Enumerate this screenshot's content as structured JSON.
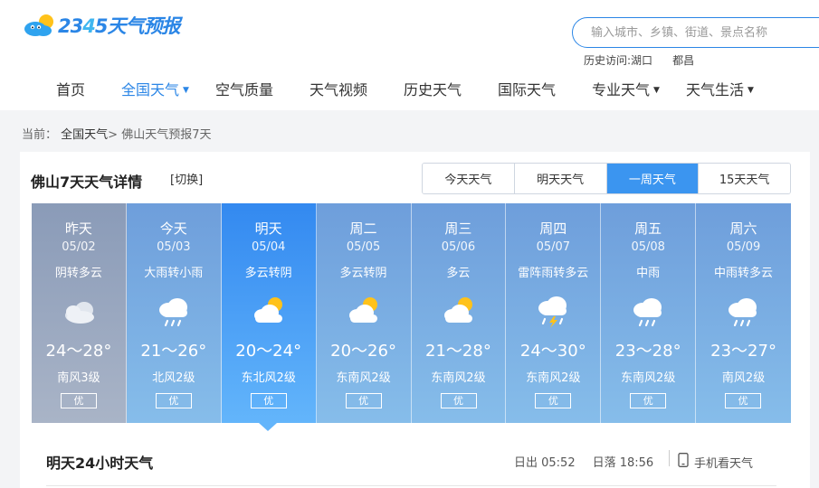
{
  "brand": {
    "logo_text_a": "23",
    "logo_text_4": "4",
    "logo_text_b": "5天气预报"
  },
  "search": {
    "placeholder": "输入城市、乡镇、街道、景点名称"
  },
  "history": {
    "label": "历史访问:",
    "items": [
      "湖口",
      "都昌"
    ]
  },
  "nav": {
    "items": [
      {
        "label": "首页"
      },
      {
        "label": "全国天气",
        "caret": "▼"
      },
      {
        "label": "空气质量"
      },
      {
        "label": "天气视频"
      },
      {
        "label": "历史天气"
      },
      {
        "label": "国际天气"
      },
      {
        "label": "专业天气",
        "caret": "▼"
      },
      {
        "label": "天气生活",
        "caret": "▼"
      }
    ]
  },
  "breadcrumb": {
    "prefix": "当前：",
    "link": "全国天气",
    "sep": ">",
    "current": "佛山天气预报7天"
  },
  "panel": {
    "title": "佛山7天天气详情",
    "switch_label": "[切换]",
    "tabs": [
      "今天天气",
      "明天天气",
      "一周天气",
      "15天天气"
    ],
    "active_tab": 2
  },
  "days": [
    {
      "name": "昨天",
      "date": "05/02",
      "cond": "阴转多云",
      "icon": "overcast-cloud-icon",
      "temp": "24～28°",
      "wind": "南风3级",
      "aqi": "优"
    },
    {
      "name": "今天",
      "date": "05/03",
      "cond": "大雨转小雨",
      "icon": "rain-icon",
      "temp": "21～26°",
      "wind": "北风2级",
      "aqi": "优"
    },
    {
      "name": "明天",
      "date": "05/04",
      "cond": "多云转阴",
      "icon": "partly-cloudy-icon",
      "temp": "20～24°",
      "wind": "东北风2级",
      "aqi": "优"
    },
    {
      "name": "周二",
      "date": "05/05",
      "cond": "多云转阴",
      "icon": "partly-cloudy-icon",
      "temp": "20～26°",
      "wind": "东南风2级",
      "aqi": "优"
    },
    {
      "name": "周三",
      "date": "05/06",
      "cond": "多云",
      "icon": "partly-cloudy-icon",
      "temp": "21～28°",
      "wind": "东南风2级",
      "aqi": "优"
    },
    {
      "name": "周四",
      "date": "05/07",
      "cond": "雷阵雨转多云",
      "icon": "thunderstorm-icon",
      "temp": "24～30°",
      "wind": "东南风2级",
      "aqi": "优"
    },
    {
      "name": "周五",
      "date": "05/08",
      "cond": "中雨",
      "icon": "rain-icon",
      "temp": "23～28°",
      "wind": "东南风2级",
      "aqi": "优"
    },
    {
      "name": "周六",
      "date": "05/09",
      "cond": "中雨转多云",
      "icon": "rain-icon",
      "temp": "23～27°",
      "wind": "南风2级",
      "aqi": "优"
    }
  ],
  "hourly": {
    "title": "明天24小时天气",
    "sunrise": "日出 05:52",
    "sunset": "日落 18:56",
    "mobile": "手机看天气"
  },
  "colors": {
    "accent": "#2b86e6",
    "selected_day": "#3389f0"
  }
}
